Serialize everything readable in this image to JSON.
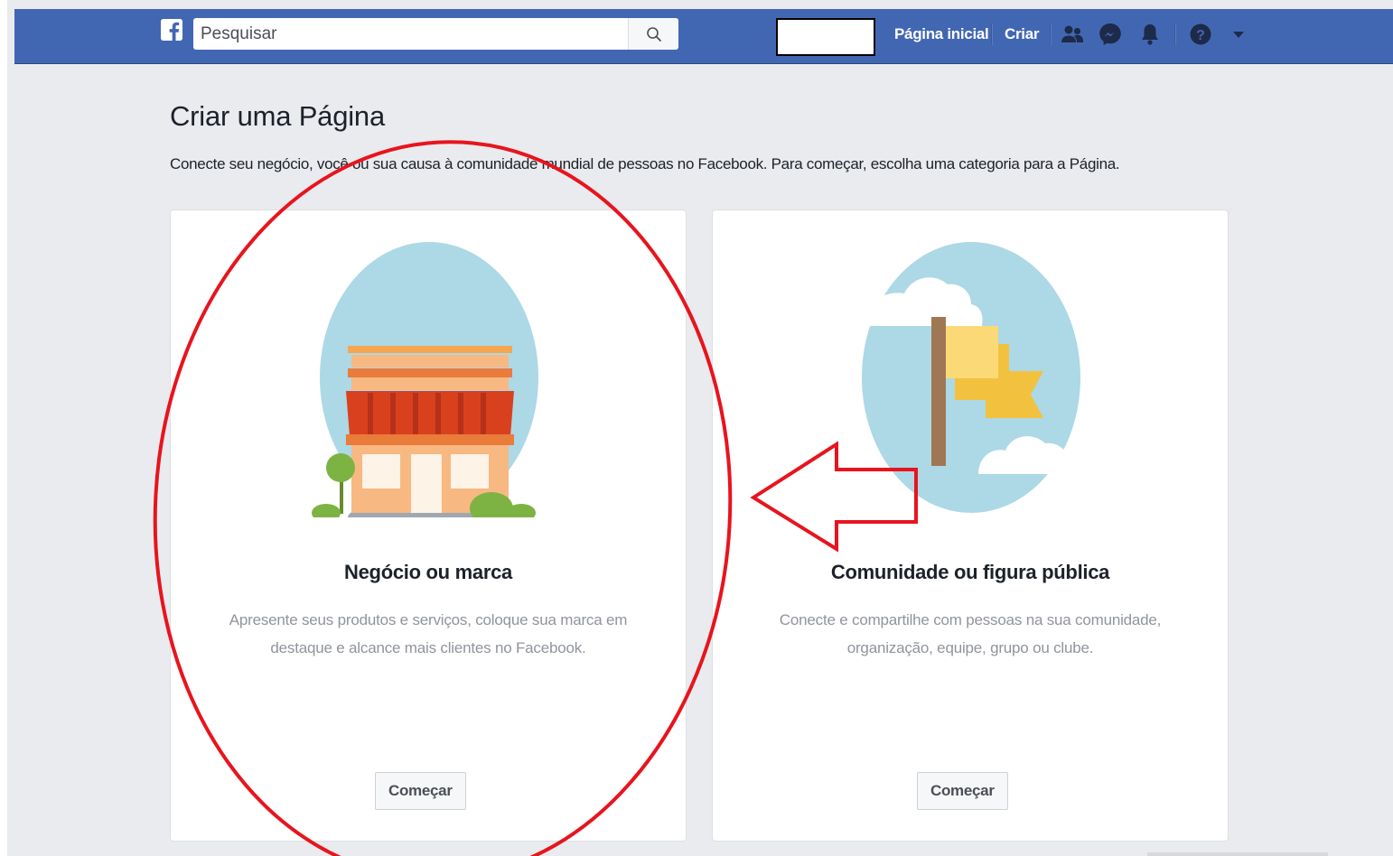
{
  "topbar": {
    "search": {
      "placeholder": "Pesquisar",
      "value": ""
    },
    "nav": {
      "home": "Página inicial",
      "create": "Criar"
    },
    "icons": [
      "facebook-logo-icon",
      "search-icon",
      "friends-icon",
      "messenger-icon",
      "notifications-bell-icon",
      "help-icon",
      "dropdown-caret-icon"
    ],
    "brand_color": "#4267b2"
  },
  "main": {
    "title": "Criar uma Página",
    "subtitle": "Conecte seu negócio, você ou sua causa à comunidade mundial de pessoas no Facebook. Para começar, escolha uma categoria para a Página.",
    "cards": [
      {
        "title": "Negócio ou marca",
        "description": "Apresente seus produtos e serviços, coloque sua marca em destaque e alcance mais clientes no Facebook.",
        "button": "Começar",
        "illustration": "storefront-illustration"
      },
      {
        "title": "Comunidade ou figura pública",
        "description": "Conecte e compartilhe com pessoas na sua comunidade, organização, equipe, grupo ou clube.",
        "button": "Começar",
        "illustration": "flag-illustration"
      }
    ]
  },
  "annotations": {
    "highlight_color": "#e8141d",
    "shapes": [
      "ellipse-around-business-card",
      "arrow-pointing-left"
    ]
  }
}
